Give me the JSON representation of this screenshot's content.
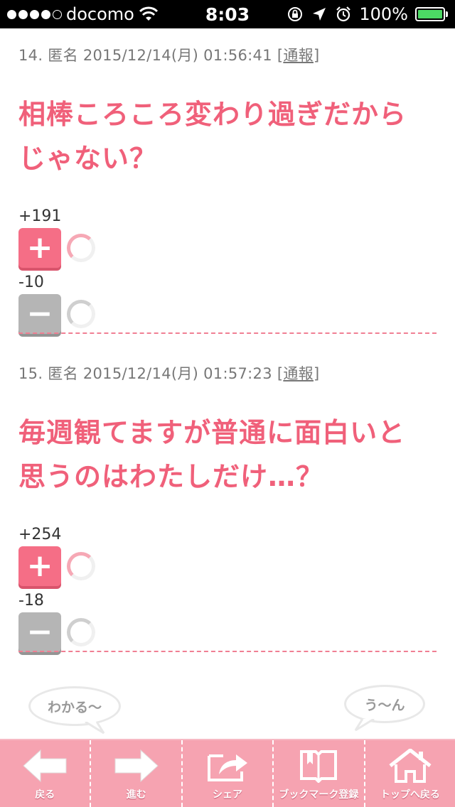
{
  "status_bar": {
    "carrier": "docomo",
    "time": "8:03",
    "battery": "100%"
  },
  "comments": [
    {
      "meta_prefix": "14. 匿名 2015/12/14(月) 01:56:41 [",
      "report": "通報",
      "meta_suffix": "]",
      "body_line1": "相棒ころころ変わり過ぎだから",
      "body_line2": "じゃない？",
      "plus_count": "+191",
      "minus_count": "-10"
    },
    {
      "meta_prefix": "15. 匿名 2015/12/14(月) 01:57:23 [",
      "report": "通報",
      "meta_suffix": "]",
      "body_line1": "毎週観てますが普通に面白いと",
      "body_line2": "思うのはわたしだけ…？",
      "plus_count": "+254",
      "minus_count": "-18"
    }
  ],
  "vote_buttons": {
    "plus": "+",
    "minus": "−"
  },
  "bubbles": {
    "left": "わかる〜",
    "right": "う〜ん"
  },
  "bottom_nav": [
    {
      "label": "戻る",
      "icon": "arrow-left-icon"
    },
    {
      "label": "進む",
      "icon": "arrow-right-icon"
    },
    {
      "label": "シェア",
      "icon": "share-icon"
    },
    {
      "label": "ブックマーク登録",
      "icon": "bookmark-icon"
    },
    {
      "label": "トップへ戻る",
      "icon": "home-icon"
    }
  ],
  "colors": {
    "accent": "#f0607a",
    "nav_background": "#f6a3b1",
    "minus_button": "#b5b5b5"
  }
}
